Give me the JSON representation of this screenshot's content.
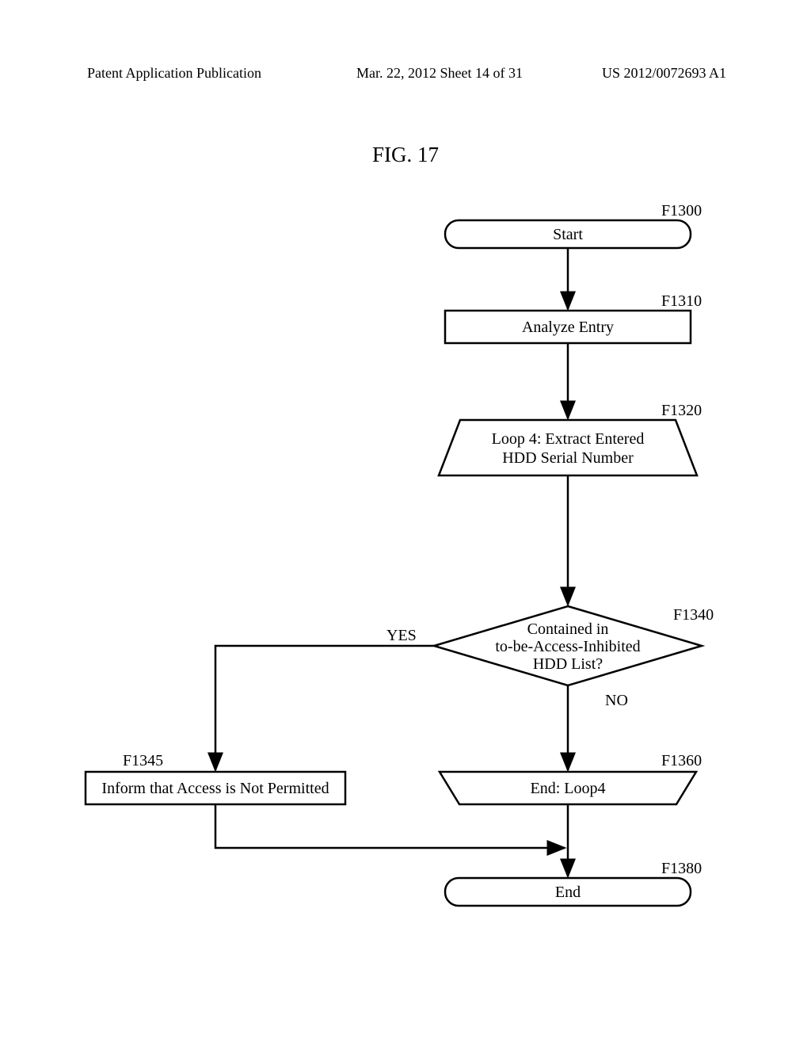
{
  "header": {
    "left": "Patent Application Publication",
    "middle": "Mar. 22, 2012  Sheet 14 of 31",
    "right": "US 2012/0072693 A1"
  },
  "figure": {
    "title": "FIG. 17"
  },
  "nodes": {
    "start": "Start",
    "analyze": "Analyze Entry",
    "loop_start_l1": "Loop 4: Extract Entered",
    "loop_start_l2": "HDD Serial Number",
    "decision_l1": "Contained in",
    "decision_l2": "to-be-Access-Inhibited",
    "decision_l3": "HDD List?",
    "inform": "Inform that Access is Not Permitted",
    "loop_end": "End: Loop4",
    "end": "End"
  },
  "branches": {
    "yes": "YES",
    "no": "NO"
  },
  "labels": {
    "start": "F1300",
    "analyze": "F1310",
    "loop_start": "F1320",
    "decision": "F1340",
    "inform": "F1345",
    "loop_end": "F1360",
    "end": "F1380"
  }
}
